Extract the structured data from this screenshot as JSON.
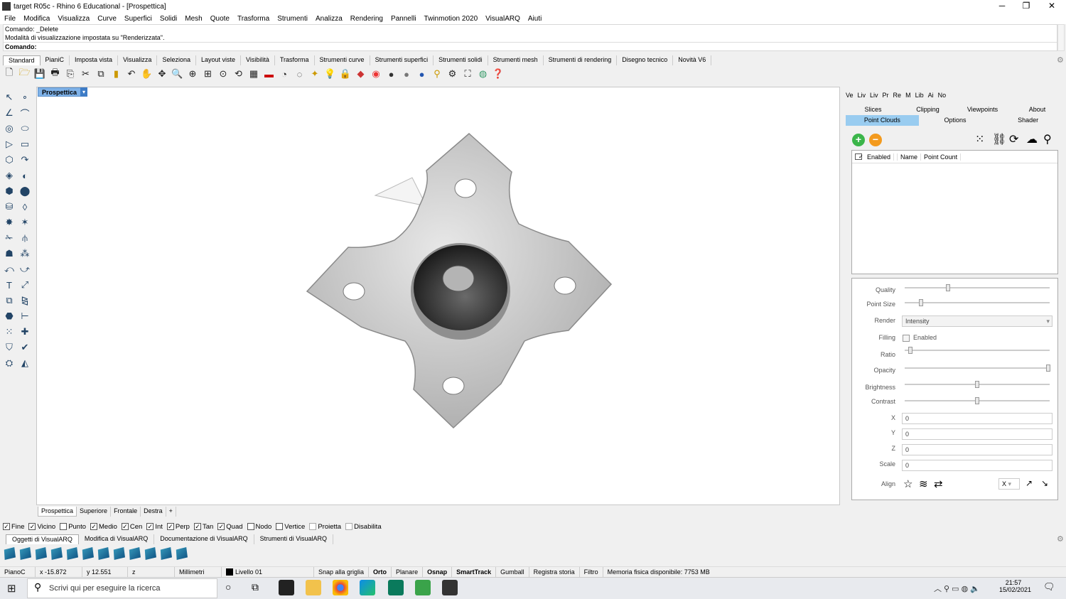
{
  "window": {
    "title": "target R05c - Rhino 6 Educational - [Prospettica]",
    "min": "─",
    "max": "❐",
    "close": "✕"
  },
  "menu": [
    "File",
    "Modifica",
    "Visualizza",
    "Curve",
    "Superfici",
    "Solidi",
    "Mesh",
    "Quote",
    "Trasforma",
    "Strumenti",
    "Analizza",
    "Rendering",
    "Pannelli",
    "Twinmotion 2020",
    "VisualARQ",
    "Aiuti"
  ],
  "command": {
    "line1": "Comando: _Delete",
    "line2": "Modalità di visualizzazione impostata su \"Renderizzata\".",
    "prompt": "Comando:"
  },
  "toolbar_tabs": [
    "Standard",
    "PianiC",
    "Imposta vista",
    "Visualizza",
    "Seleziona",
    "Layout viste",
    "Visibilità",
    "Trasforma",
    "Strumenti curve",
    "Strumenti superfici",
    "Strumenti solidi",
    "Strumenti mesh",
    "Strumenti di rendering",
    "Disegno tecnico",
    "Novità V6"
  ],
  "viewport": {
    "title": "Prospettica",
    "tabs": [
      "Prospettica",
      "Superiore",
      "Frontale",
      "Destra"
    ],
    "add": "+"
  },
  "panel": {
    "tabs": [
      "Ve",
      "Liv",
      "Liv",
      "Pr",
      "Re",
      "M",
      "Lib",
      "Ai",
      "No"
    ],
    "row1": [
      "Slices",
      "Clipping",
      "Viewpoints",
      "About"
    ],
    "row2": [
      "Point Clouds",
      "Options",
      "Shader"
    ],
    "list_headers": [
      "Enabled",
      "Name",
      "Point Count"
    ],
    "labels": {
      "quality": "Quality",
      "point_size": "Point Size",
      "render": "Render",
      "filling": "Filling",
      "ratio": "Ratio",
      "opacity": "Opacity",
      "brightness": "Brightness",
      "contrast": "Contrast",
      "x": "X",
      "y": "Y",
      "z": "Z",
      "scale": "Scale",
      "align": "Align"
    },
    "render_value": "Intensity",
    "filling_value": "Enabled",
    "x_value": "0",
    "y_value": "0",
    "z_value": "0",
    "scale_value": "0",
    "align_axis": "X"
  },
  "osnaps": [
    {
      "label": "Fine",
      "on": true
    },
    {
      "label": "Vicino",
      "on": true
    },
    {
      "label": "Punto",
      "on": false
    },
    {
      "label": "Medio",
      "on": true
    },
    {
      "label": "Cen",
      "on": true
    },
    {
      "label": "Int",
      "on": true
    },
    {
      "label": "Perp",
      "on": true
    },
    {
      "label": "Tan",
      "on": true
    },
    {
      "label": "Quad",
      "on": true
    },
    {
      "label": "Nodo",
      "on": false
    },
    {
      "label": "Vertice",
      "on": false
    },
    {
      "label": "Proietta",
      "on": false
    },
    {
      "label": "Disabilita",
      "on": false
    }
  ],
  "va_tabs": [
    "Oggetti di VisualARQ",
    "Modifica di VisualARQ",
    "Documentazione di VisualARQ",
    "Strumenti di VisualARQ"
  ],
  "status": {
    "cplane": "PianoC",
    "x": "x -15.872",
    "y": "y 12.551",
    "z": "z",
    "units": "Millimetri",
    "layer": "Livello 01",
    "snap": "Snap alla griglia",
    "orto": "Orto",
    "planare": "Planare",
    "osnap": "Osnap",
    "smarttrack": "SmartTrack",
    "gumball": "Gumball",
    "history": "Registra storia",
    "filter": "Filtro",
    "memory": "Memoria fisica disponibile: 7753 MB"
  },
  "taskbar": {
    "search": "Scrivi qui per eseguire la ricerca",
    "time": "21:57",
    "date": "15/02/2021",
    "notif": "2"
  }
}
